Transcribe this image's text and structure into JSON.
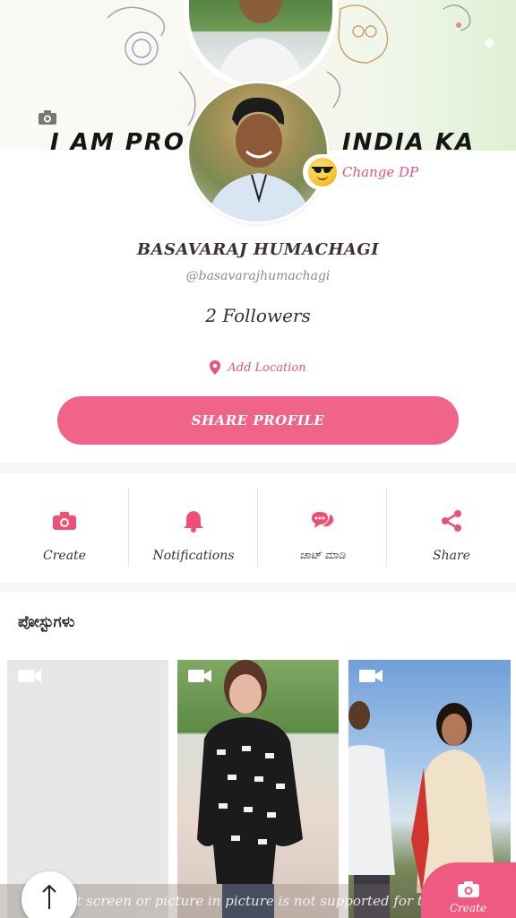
{
  "cover": {
    "text_left": "I AM PRO",
    "text_right": "INDIA KA"
  },
  "profile": {
    "change_dp_label": "Change DP",
    "name": "BASAVARAJ HUMACHAGI",
    "handle": "@basavarajhumachagi",
    "followers": "2 Followers",
    "add_location": "Add Location",
    "share_profile": "SHARE PROFILE"
  },
  "actions": [
    {
      "label": "Create",
      "icon": "camera-icon"
    },
    {
      "label": "Notifications",
      "icon": "bell-icon"
    },
    {
      "label": "ಚಾಟ್ ಮಾಡಿ",
      "icon": "chat-icon"
    },
    {
      "label": "Share",
      "icon": "share-icon"
    }
  ],
  "posts": {
    "title": "ಪೋಸ್ಟುಗಳು"
  },
  "overlay": {
    "toast": "Split screen or picture in picture is not supported for this app",
    "create_label": "Create"
  },
  "colors": {
    "accent": "#f1648a",
    "accent_text": "#e8547d"
  }
}
